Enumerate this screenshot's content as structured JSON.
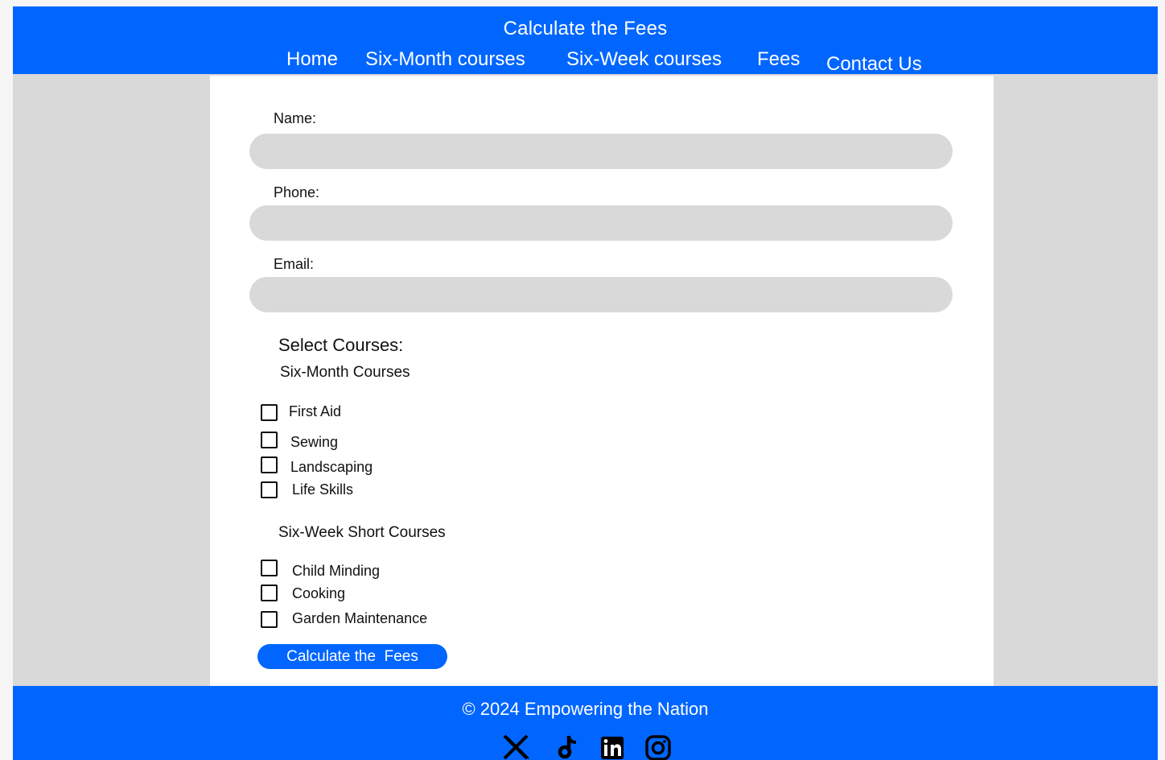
{
  "header": {
    "title": "Calculate the Fees",
    "nav": {
      "home": "Home",
      "six_month": "Six-Month courses",
      "six_week": "Six-Week courses",
      "fees": "Fees",
      "contact": "Contact Us"
    }
  },
  "form": {
    "name_label": "Name:",
    "name_value": "",
    "phone_label": "Phone:",
    "phone_value": "",
    "email_label": "Email:",
    "email_value": "",
    "select_title": "Select Courses:",
    "six_month_title": "Six-Month Courses",
    "six_month_courses": [
      "First Aid",
      "Sewing",
      "Landscaping",
      "Life Skills"
    ],
    "six_week_title": "Six-Week Short Courses",
    "six_week_courses": [
      "Child Minding",
      "Cooking",
      "Garden Maintenance"
    ],
    "submit_label": "Calculate the  Fees"
  },
  "footer": {
    "copyright": "© 2024 Empowering the Nation",
    "social_icons": [
      "x-icon",
      "tiktok-icon",
      "linkedin-icon",
      "instagram-icon"
    ]
  },
  "colors": {
    "brand_blue": "#0066ff",
    "background_gray": "#d9d9d9",
    "panel_white": "#ffffff",
    "text_dark": "#111111"
  }
}
